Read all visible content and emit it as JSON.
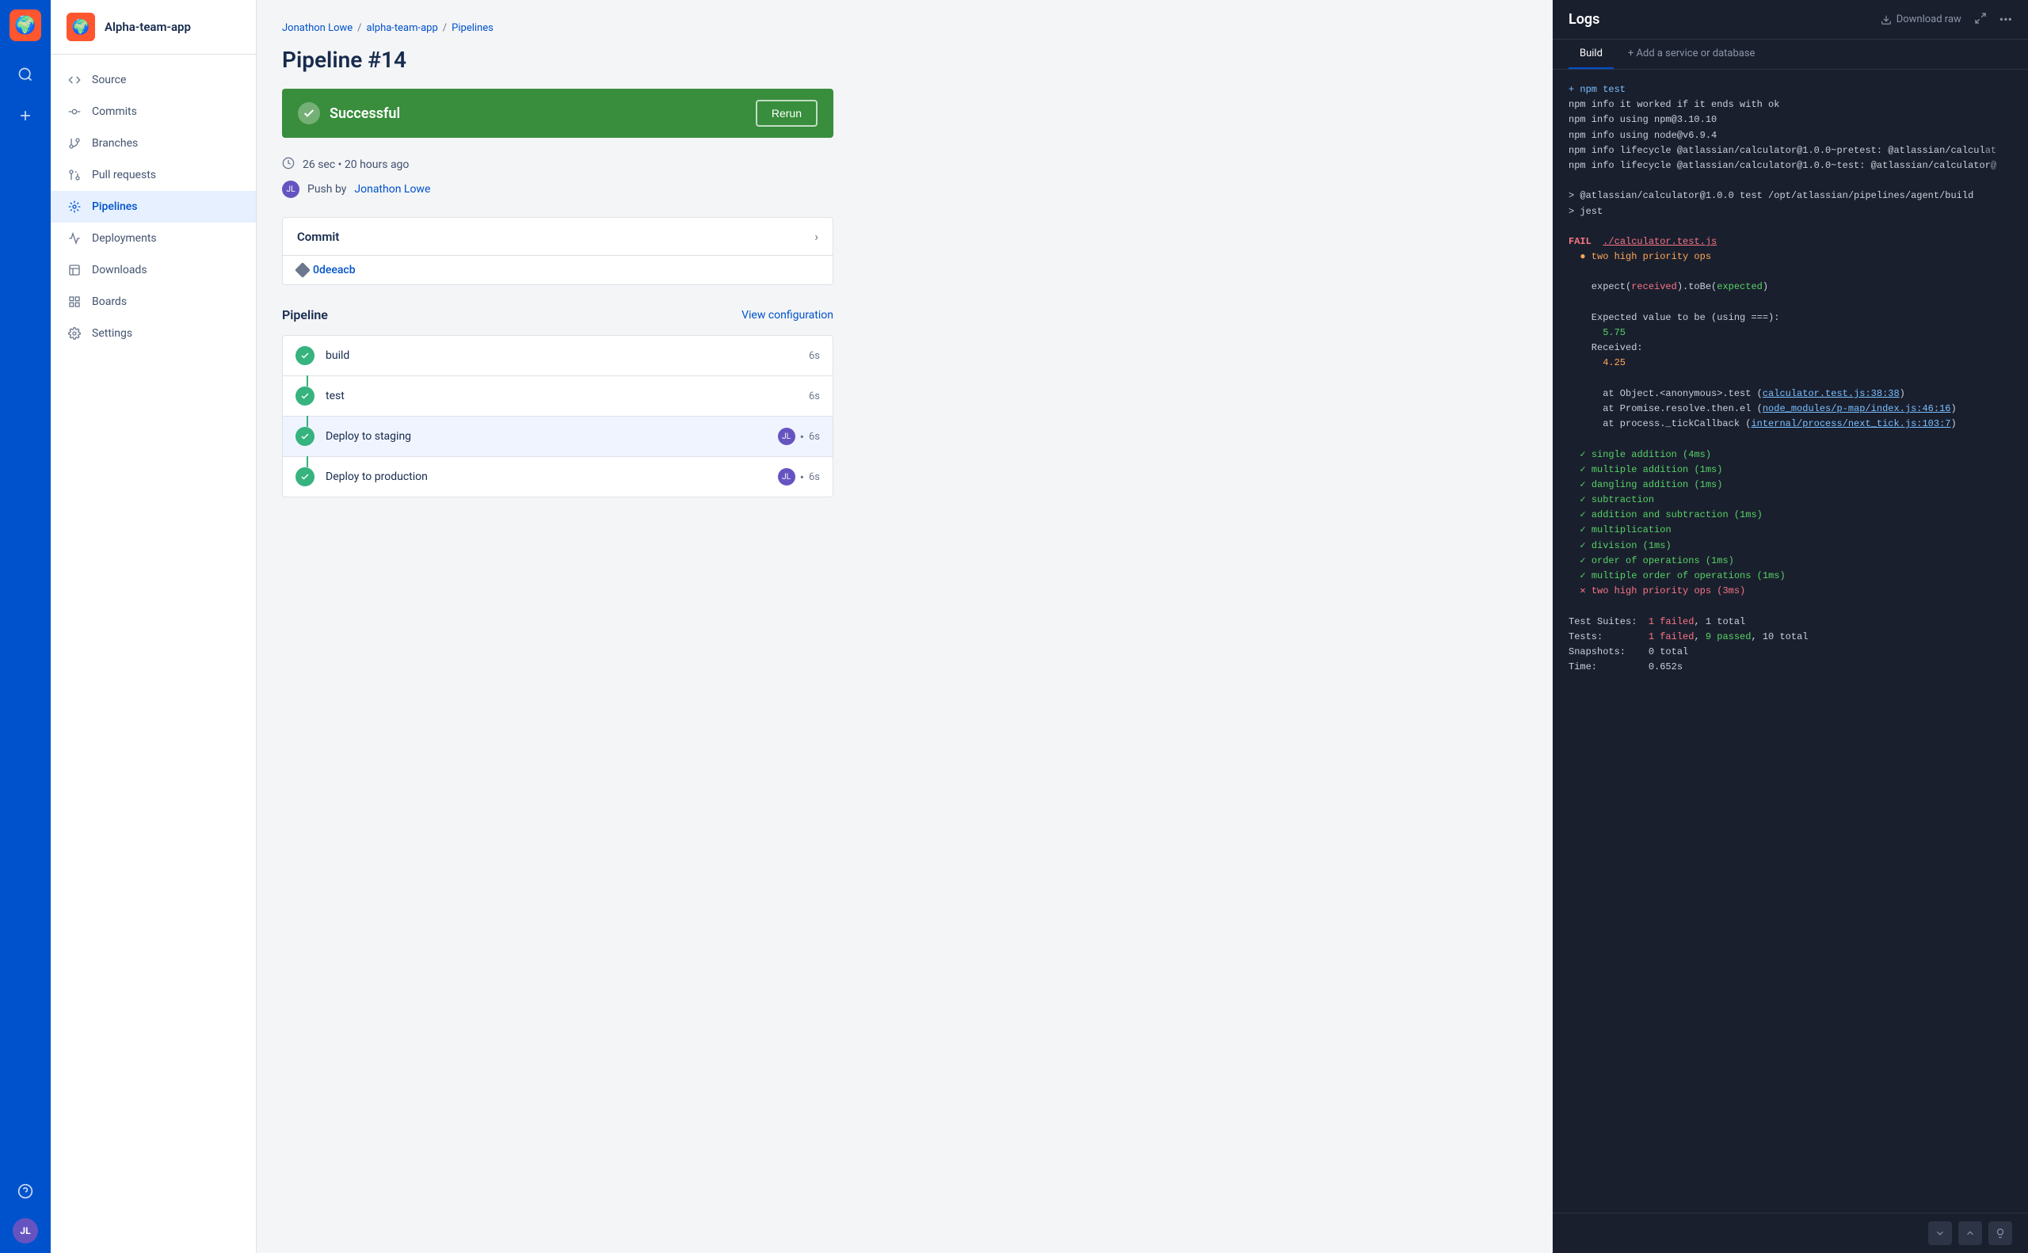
{
  "app": {
    "name": "Alpha-team-app",
    "logo_emoji": "🌍"
  },
  "iconBar": {
    "search_label": "Search",
    "add_label": "Add",
    "help_label": "Help",
    "avatar_initials": "JL"
  },
  "sidebar": {
    "title": "Alpha-team-app",
    "nav": [
      {
        "id": "source",
        "label": "Source",
        "active": false
      },
      {
        "id": "commits",
        "label": "Commits",
        "active": false
      },
      {
        "id": "branches",
        "label": "Branches",
        "active": false
      },
      {
        "id": "pull-requests",
        "label": "Pull requests",
        "active": false
      },
      {
        "id": "pipelines",
        "label": "Pipelines",
        "active": true
      },
      {
        "id": "deployments",
        "label": "Deployments",
        "active": false
      },
      {
        "id": "downloads",
        "label": "Downloads",
        "active": false
      },
      {
        "id": "boards",
        "label": "Boards",
        "active": false
      },
      {
        "id": "settings",
        "label": "Settings",
        "active": false
      }
    ]
  },
  "breadcrumb": {
    "user": "Jonathon Lowe",
    "repo": "alpha-team-app",
    "section": "Pipelines"
  },
  "pipeline": {
    "title": "Pipeline #14",
    "status": "Successful",
    "rerun_label": "Rerun",
    "duration": "26 sec",
    "age": "20 hours ago",
    "push_by_label": "Push by",
    "push_by_user": "Jonathon Lowe",
    "commit_label": "Commit",
    "commit_hash": "0deeacb",
    "pipeline_label": "Pipeline",
    "view_config_label": "View configuration",
    "steps": [
      {
        "name": "build",
        "time": "6s",
        "has_avatar": false
      },
      {
        "name": "test",
        "time": "6s",
        "has_avatar": false
      },
      {
        "name": "Deploy to staging",
        "time": "6s",
        "has_avatar": true,
        "active": true
      },
      {
        "name": "Deploy to production",
        "time": "6s",
        "has_avatar": true
      }
    ]
  },
  "logs": {
    "title": "Logs",
    "download_raw_label": "Download raw",
    "tabs": [
      {
        "label": "Build",
        "active": true
      },
      {
        "label": "+ Add a service or database",
        "active": false
      }
    ],
    "lines": [
      {
        "type": "cmd",
        "text": "+ npm test"
      },
      {
        "type": "info",
        "text": "npm info it worked if it ends with ok"
      },
      {
        "type": "info",
        "text": "npm info using npm@3.10.10"
      },
      {
        "type": "info",
        "text": "npm info using node@v6.9.4"
      },
      {
        "type": "info",
        "text": "npm info lifecycle @atlassian/calculator@1.0.0~pretest: @atlassian/calcul..."
      },
      {
        "type": "info",
        "text": "npm info lifecycle @atlassian/calculator@1.0.0~test: @atlassian/calculator..."
      },
      {
        "type": "blank",
        "text": ""
      },
      {
        "type": "info",
        "text": "> @atlassian/calculator@1.0.0 test /opt/atlassian/pipelines/agent/build"
      },
      {
        "type": "info",
        "text": "> jest"
      },
      {
        "type": "blank",
        "text": ""
      },
      {
        "type": "fail",
        "text": "FAIL  ./calculator.test.js"
      },
      {
        "type": "fail_msg",
        "text": "  ● two high priority ops"
      },
      {
        "type": "blank",
        "text": ""
      },
      {
        "type": "expect",
        "text": "    expect(received).toBe(expected)"
      },
      {
        "type": "blank",
        "text": ""
      },
      {
        "type": "expect",
        "text": "    Expected value to be (using ===):"
      },
      {
        "type": "value_pass",
        "text": "      5.75"
      },
      {
        "type": "expect",
        "text": "    Received:"
      },
      {
        "type": "value_fail",
        "text": "      4.25"
      },
      {
        "type": "blank",
        "text": ""
      },
      {
        "type": "info",
        "text": "      at Object.<anonymous>.test (calculator.test.js:38:38)"
      },
      {
        "type": "link_line",
        "text": "      at Promise.resolve.then.el (node_modules/p-map/index.js:46:16)"
      },
      {
        "type": "link_line2",
        "text": "      at process._tickCallback (internal/process/next_tick.js:103:7)"
      },
      {
        "type": "blank",
        "text": ""
      },
      {
        "type": "pass",
        "text": "  ✓ single addition (4ms)"
      },
      {
        "type": "pass",
        "text": "  ✓ multiple addition (1ms)"
      },
      {
        "type": "pass",
        "text": "  ✓ dangling addition (1ms)"
      },
      {
        "type": "pass",
        "text": "  ✓ subtraction"
      },
      {
        "type": "pass",
        "text": "  ✓ addition and subtraction (1ms)"
      },
      {
        "type": "pass",
        "text": "  ✓ multiplication"
      },
      {
        "type": "pass",
        "text": "  ✓ division (1ms)"
      },
      {
        "type": "pass",
        "text": "  ✓ order of operations (1ms)"
      },
      {
        "type": "pass",
        "text": "  ✓ multiple order of operations (1ms)"
      },
      {
        "type": "x",
        "text": "  ✕ two high priority ops (3ms)"
      },
      {
        "type": "blank",
        "text": ""
      },
      {
        "type": "summary",
        "text": "Test Suites:  1 failed, 1 total"
      },
      {
        "type": "summary_fail",
        "text": "Tests:        1 failed, 9 passed, 10 total"
      },
      {
        "type": "summary",
        "text": "Snapshots:    0 total"
      },
      {
        "type": "summary",
        "text": "Time:         0.652s"
      }
    ]
  }
}
